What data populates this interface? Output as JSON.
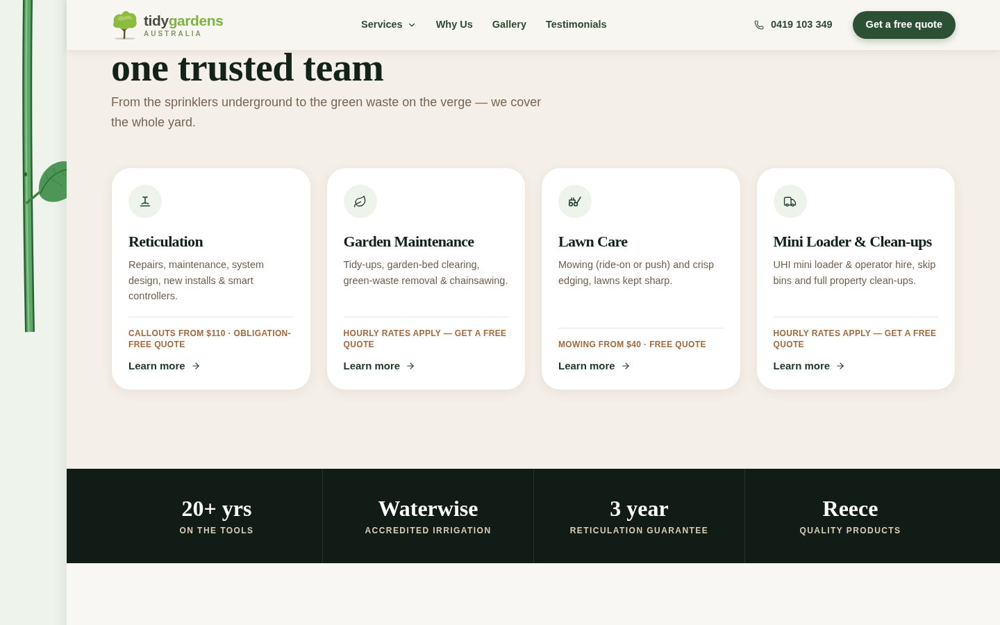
{
  "header": {
    "logo": {
      "word_1": "tidy",
      "word_2": "gardens",
      "tagline": "AUSTRALIA"
    },
    "nav": [
      {
        "label": "Services",
        "dropdown": true
      },
      {
        "label": "Why Us",
        "dropdown": false
      },
      {
        "label": "Gallery",
        "dropdown": false
      },
      {
        "label": "Testimonials",
        "dropdown": false
      }
    ],
    "phone": "0419 103 349",
    "cta": "Get a free quote"
  },
  "intro": {
    "heading": "one trusted team",
    "subtitle": "From the sprinklers underground to the green waste on the verge — we cover the whole yard."
  },
  "services": [
    {
      "title": "Reticulation",
      "description": "Repairs, maintenance, system design, new installs & smart controllers.",
      "note": "CALLOUTS FROM $110 · OBLIGATION-FREE QUOTE",
      "link": "Learn more"
    },
    {
      "title": "Garden Maintenance",
      "description": "Tidy-ups, garden-bed clearing, green-waste removal & chainsawing.",
      "note": "HOURLY RATES APPLY — GET A FREE QUOTE",
      "link": "Learn more"
    },
    {
      "title": "Lawn Care",
      "description": "Mowing (ride-on or push) and crisp edging, lawns kept sharp.",
      "note": "MOWING FROM $40 · FREE QUOTE",
      "link": "Learn more"
    },
    {
      "title": "Mini Loader & Clean-ups",
      "description": "UHI mini loader & operator hire, skip bins and full property clean-ups.",
      "note": "HOURLY RATES APPLY — GET A FREE QUOTE",
      "link": "Learn more"
    }
  ],
  "stats": [
    {
      "value": "20+ yrs",
      "label": "ON THE TOOLS"
    },
    {
      "value": "Waterwise",
      "label": "ACCREDITED IRRIGATION"
    },
    {
      "value": "3 year",
      "label": "RETICULATION GUARANTEE"
    },
    {
      "value": "Reece",
      "label": "QUALITY PRODUCTS"
    }
  ]
}
